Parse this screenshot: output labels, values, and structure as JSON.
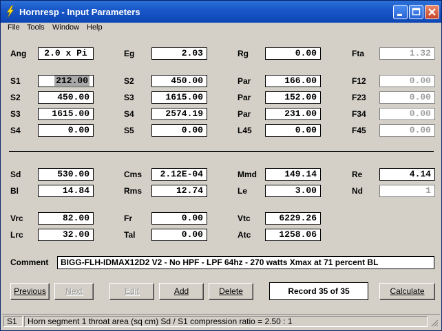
{
  "window": {
    "title": "Hornresp - Input Parameters"
  },
  "menu": [
    "File",
    "Tools",
    "Window",
    "Help"
  ],
  "rows1": [
    [
      {
        "label": "Ang",
        "value": "2.0 x Pi"
      },
      {
        "label": "Eg",
        "value": "2.03"
      },
      {
        "label": "Rg",
        "value": "0.00"
      },
      {
        "label": "Fta",
        "value": "1.32"
      }
    ],
    [
      {
        "label": "S1",
        "value": "212.00"
      },
      {
        "label": "S2",
        "value": "450.00"
      },
      {
        "label": "Par",
        "value": "166.00"
      },
      {
        "label": "F12",
        "value": "0.00"
      }
    ],
    [
      {
        "label": "S2",
        "value": "450.00"
      },
      {
        "label": "S3",
        "value": "1615.00"
      },
      {
        "label": "Par",
        "value": "152.00"
      },
      {
        "label": "F23",
        "value": "0.00"
      }
    ],
    [
      {
        "label": "S3",
        "value": "1615.00"
      },
      {
        "label": "S4",
        "value": "2574.19"
      },
      {
        "label": "Par",
        "value": "231.00"
      },
      {
        "label": "F34",
        "value": "0.00"
      }
    ],
    [
      {
        "label": "S4",
        "value": "0.00"
      },
      {
        "label": "S5",
        "value": "0.00"
      },
      {
        "label": "L45",
        "value": "0.00"
      },
      {
        "label": "F45",
        "value": "0.00"
      }
    ]
  ],
  "rows2": [
    [
      {
        "label": "Sd",
        "value": "530.00"
      },
      {
        "label": "Cms",
        "value": "2.12E-04"
      },
      {
        "label": "Mmd",
        "value": "149.14"
      },
      {
        "label": "Re",
        "value": "4.14"
      }
    ],
    [
      {
        "label": "Bl",
        "value": "14.84"
      },
      {
        "label": "Rms",
        "value": "12.74"
      },
      {
        "label": "Le",
        "value": "3.00"
      },
      {
        "label": "Nd",
        "value": "1"
      }
    ],
    [
      {
        "label": "Vrc",
        "value": "82.00"
      },
      {
        "label": "Fr",
        "value": "0.00"
      },
      {
        "label": "Vtc",
        "value": "6229.26"
      }
    ],
    [
      {
        "label": "Lrc",
        "value": "32.00"
      },
      {
        "label": "Tal",
        "value": "0.00"
      },
      {
        "label": "Atc",
        "value": "1258.06"
      }
    ]
  ],
  "comment": {
    "label": "Comment",
    "value": "BIGG-FLH-IDMAX12D2 V2 - No HPF - LPF 64hz - 270 watts Xmax at 71 percent BL"
  },
  "buttons": {
    "previous": "Previous",
    "next": "Next",
    "edit": "Edit",
    "add": "Add",
    "delete": "Delete",
    "calculate": "Calculate"
  },
  "record": "Record 35 of 35",
  "status": {
    "field": "S1",
    "description": "Horn segment 1 throat area  (sq cm)    Sd / S1 compression ratio = 2.50 : 1"
  },
  "colors": {
    "title_bar": "#0c46b4",
    "window_bg": "#d4d0c8",
    "disabled_text": "#a0a0a0"
  },
  "icons": [
    "lightning-app-icon",
    "minimize-icon",
    "maximize-icon",
    "close-icon",
    "resize-grip-icon"
  ]
}
